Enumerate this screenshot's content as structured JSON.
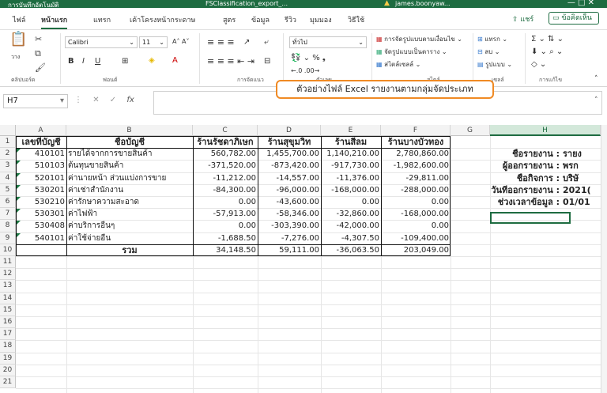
{
  "titlebar": {
    "autosave": "การบันทึกอัตโนมัติ",
    "filename": "FSClassification_export_...",
    "user": "james.boonyaw...",
    "controls": "—   □   ✕"
  },
  "tabs": [
    "ไฟล์",
    "หน้าแรก",
    "แทรก",
    "เค้าโครงหน้ากระดาษ",
    "สูตร",
    "ข้อมูล",
    "รีวิว",
    "มุมมอง",
    "วิธีใช้"
  ],
  "share_label": "แชร์",
  "comments_label": "ข้อคิดเห็น",
  "ribbon": {
    "clipboard_label": "คลิปบอร์ด",
    "paste_label": "วาง",
    "font_name": "Calibri",
    "font_size": "11",
    "font_label": "ฟอนต์",
    "alignment_label": "การจัดแนว",
    "number_format": "ทั่วไป",
    "number_label": "ตัวเลข",
    "styles": [
      "การจัดรูปแบบตามเงื่อนไข",
      "จัดรูปแบบเป็นตาราง",
      "สไตล์เซลล์"
    ],
    "styles_label": "สไตล์",
    "cells": [
      "แทรก",
      "ลบ",
      "รูปแบบ"
    ],
    "cells_label": "เซลล์",
    "editing_label": "การแก้ไข"
  },
  "formula_bar": {
    "name_box": "H7",
    "fx": "fx",
    "value": ""
  },
  "callout": "ตัวอย่างไฟล์ Excel รายงานตามกลุ่มจัดประเภท",
  "columns": [
    "A",
    "B",
    "C",
    "D",
    "E",
    "F",
    "G",
    "H"
  ],
  "selected_column": "H",
  "rows": [
    "1",
    "2",
    "3",
    "4",
    "5",
    "6",
    "7",
    "8",
    "9",
    "10",
    "11",
    "12",
    "13",
    "14",
    "15",
    "16",
    "17",
    "18",
    "19",
    "20",
    "21"
  ],
  "table": {
    "headers": [
      "เลขที่บัญชี",
      "ชื่อบัญชี",
      "ร้านรัชดาภิเษก",
      "ร้านสุขุมวิท",
      "ร้านสีลม",
      "ร้านบางบัวทอง"
    ],
    "data": [
      [
        "410101",
        "รายได้จากการขายสินค้า",
        "560,782.00",
        "1,455,700.00",
        "1,140,210.00",
        "2,780,860.00"
      ],
      [
        "510103",
        "ต้นทุนขายสินค้า",
        "-371,520.00",
        "-873,420.00",
        "-917,730.00",
        "-1,982,600.00"
      ],
      [
        "520101",
        "ค่านายหน้า ส่วนแบ่งการขาย",
        "-11,212.00",
        "-14,557.00",
        "-11,376.00",
        "-29,811.00"
      ],
      [
        "530201",
        "ค่าเช่าสำนักงาน",
        "-84,300.00",
        "-96,000.00",
        "-168,000.00",
        "-288,000.00"
      ],
      [
        "530210",
        "ค่ารักษาความสะอาด",
        "0.00",
        "-43,600.00",
        "0.00",
        "0.00"
      ],
      [
        "530301",
        "ค่าไฟฟ้า",
        "-57,913.00",
        "-58,346.00",
        "-32,860.00",
        "-168,000.00"
      ],
      [
        "530408",
        "ค่าบริการอื่นๆ",
        "0.00",
        "-303,390.00",
        "-42,000.00",
        "0.00"
      ],
      [
        "540101",
        "ค่าใช้จ่ายอื่น",
        "-1,688.50",
        "-7,276.00",
        "-4,307.50",
        "-109,400.00"
      ]
    ],
    "total_label": "รวม",
    "totals": [
      "34,148.50",
      "59,111.00",
      "-36,063.50",
      "203,049.00"
    ]
  },
  "info": [
    {
      "label": "ชื่อรายงาน :",
      "value": "รายง"
    },
    {
      "label": "ผู้ออกรายงาน :",
      "value": "พรก"
    },
    {
      "label": "ชื่อกิจการ :",
      "value": "บริษั"
    },
    {
      "label": "วันที่ออกรายงาน :",
      "value": "2021("
    },
    {
      "label": "ช่วงเวลาข้อมูล :",
      "value": "01/01"
    }
  ]
}
